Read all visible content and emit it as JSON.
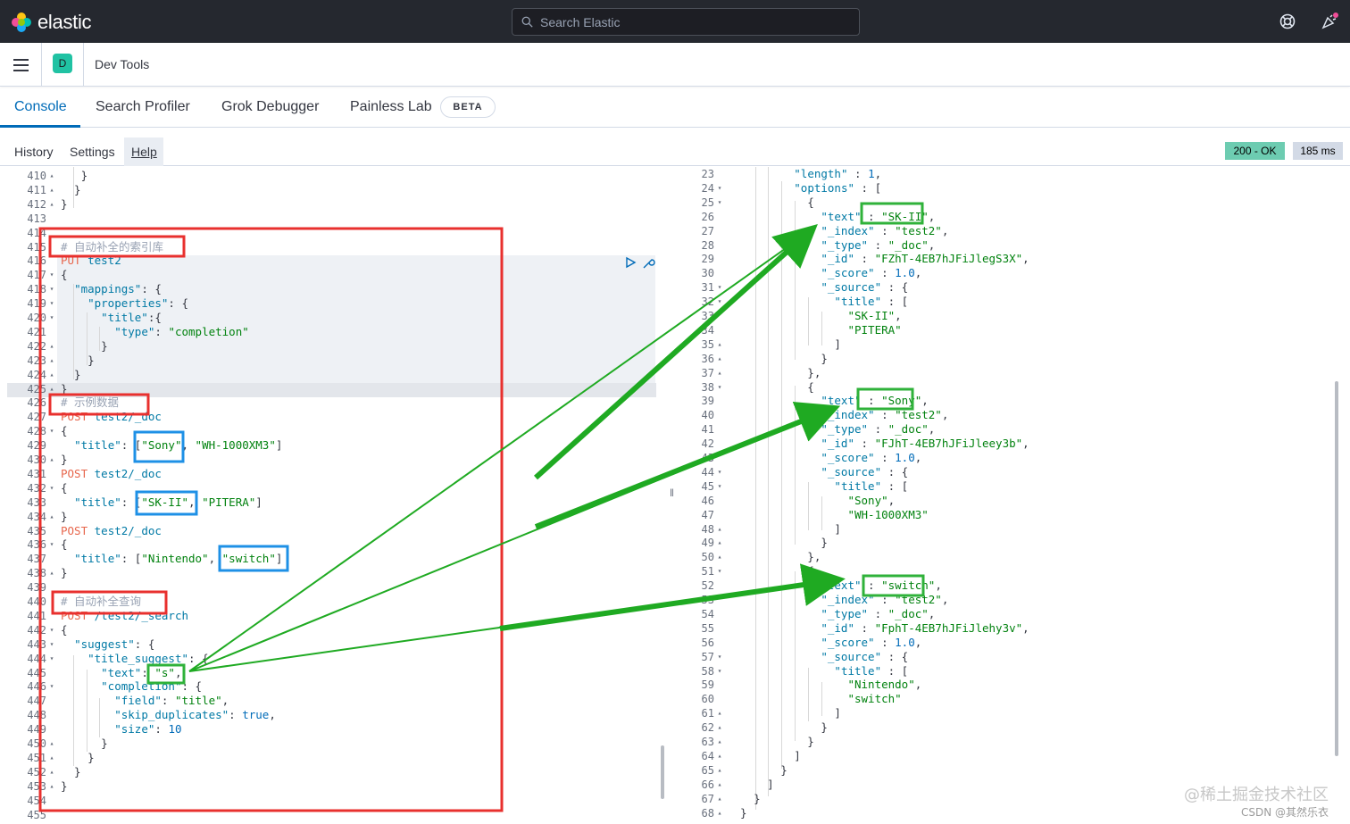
{
  "brand": {
    "name": "elastic"
  },
  "search": {
    "placeholder": "Search Elastic"
  },
  "topbar": {
    "help_icon": "help-lifebuoy-icon",
    "news_icon": "newsfeed-icon"
  },
  "breadcrumb": {
    "avatar_letter": "D",
    "title": "Dev Tools"
  },
  "tabs": [
    {
      "label": "Console",
      "active": true
    },
    {
      "label": "Search Profiler"
    },
    {
      "label": "Grok Debugger"
    },
    {
      "label": "Painless Lab"
    }
  ],
  "beta_badge": "BETA",
  "subnav": {
    "history": "History",
    "settings": "Settings",
    "help": "Help"
  },
  "status": {
    "code": "200 - OK",
    "time": "185 ms",
    "ok_color": "#6dccb1"
  },
  "editor_lines": [
    {
      "n": "410",
      "f": "▴",
      "html": "   }"
    },
    {
      "n": "411",
      "f": "▴",
      "html": "  }"
    },
    {
      "n": "412",
      "f": "▴",
      "html": "}"
    },
    {
      "n": "413",
      "f": "",
      "html": ""
    },
    {
      "n": "414",
      "f": "",
      "html": ""
    },
    {
      "n": "415",
      "f": "",
      "html": "<span class='cm'># 自动补全的索引库</span>"
    },
    {
      "n": "416",
      "f": "",
      "html": "<span class='m'>PUT</span> <span class='k'>test2</span>"
    },
    {
      "n": "417",
      "f": "▾",
      "html": "{"
    },
    {
      "n": "418",
      "f": "▾",
      "html": "  <span class='k'>\"mappings\"</span>: {"
    },
    {
      "n": "419",
      "f": "▾",
      "html": "    <span class='k'>\"properties\"</span>: {"
    },
    {
      "n": "420",
      "f": "▾",
      "html": "      <span class='k'>\"title\"</span>:{"
    },
    {
      "n": "421",
      "f": "",
      "html": "        <span class='k'>\"type\"</span>: <span class='s'>\"completion\"</span>"
    },
    {
      "n": "422",
      "f": "▴",
      "html": "      }"
    },
    {
      "n": "423",
      "f": "▴",
      "html": "    }"
    },
    {
      "n": "424",
      "f": "▴",
      "html": "  }"
    },
    {
      "n": "425",
      "f": "▴",
      "html": "}"
    },
    {
      "n": "426",
      "f": "",
      "html": "<span class='cm'># 示例数据</span>"
    },
    {
      "n": "427",
      "f": "",
      "html": "<span class='m'>POST</span> <span class='k'>test2/_doc</span>"
    },
    {
      "n": "428",
      "f": "▾",
      "html": "{"
    },
    {
      "n": "429",
      "f": "",
      "html": "  <span class='k'>\"title\"</span>: [<span class='s'>\"Sony\"</span>, <span class='s'>\"WH-1000XM3\"</span>]"
    },
    {
      "n": "430",
      "f": "▴",
      "html": "}"
    },
    {
      "n": "431",
      "f": "",
      "html": "<span class='m'>POST</span> <span class='k'>test2/_doc</span>"
    },
    {
      "n": "432",
      "f": "▾",
      "html": "{"
    },
    {
      "n": "433",
      "f": "",
      "html": "  <span class='k'>\"title\"</span>: [<span class='s'>\"SK-II\"</span>, <span class='s'>\"PITERA\"</span>]"
    },
    {
      "n": "434",
      "f": "▴",
      "html": "}"
    },
    {
      "n": "435",
      "f": "",
      "html": "<span class='m'>POST</span> <span class='k'>test2/_doc</span>"
    },
    {
      "n": "436",
      "f": "▾",
      "html": "{"
    },
    {
      "n": "437",
      "f": "",
      "html": "  <span class='k'>\"title\"</span>: [<span class='s'>\"Nintendo\"</span>, <span class='s'>\"switch\"</span>]"
    },
    {
      "n": "438",
      "f": "▴",
      "html": "}"
    },
    {
      "n": "439",
      "f": "",
      "html": ""
    },
    {
      "n": "440",
      "f": "",
      "html": "<span class='cm'># 自动补全查询</span>"
    },
    {
      "n": "441",
      "f": "",
      "html": "<span class='m'>POST</span> <span class='k'>/test2/_search</span>"
    },
    {
      "n": "442",
      "f": "▾",
      "html": "{"
    },
    {
      "n": "443",
      "f": "▾",
      "html": "  <span class='k'>\"suggest\"</span>: {"
    },
    {
      "n": "444",
      "f": "▾",
      "html": "    <span class='k'>\"title_suggest\"</span>: {"
    },
    {
      "n": "445",
      "f": "",
      "html": "      <span class='k'>\"text\"</span>: <span class='s'>\"s\"</span>,"
    },
    {
      "n": "446",
      "f": "▾",
      "html": "      <span class='k'>\"completion\"</span>: {"
    },
    {
      "n": "447",
      "f": "",
      "html": "        <span class='k'>\"field\"</span>: <span class='s'>\"title\"</span>,"
    },
    {
      "n": "448",
      "f": "",
      "html": "        <span class='k'>\"skip_duplicates\"</span>: <span class='num'>true</span>,"
    },
    {
      "n": "449",
      "f": "",
      "html": "        <span class='k'>\"size\"</span>: <span class='num'>10</span>"
    },
    {
      "n": "450",
      "f": "▴",
      "html": "      }"
    },
    {
      "n": "451",
      "f": "▴",
      "html": "    }"
    },
    {
      "n": "452",
      "f": "▴",
      "html": "  }"
    },
    {
      "n": "453",
      "f": "▴",
      "html": "}"
    },
    {
      "n": "454",
      "f": "",
      "html": ""
    },
    {
      "n": "455",
      "f": "",
      "html": ""
    }
  ],
  "output_lines": [
    {
      "n": "23",
      "f": "",
      "html": "          <span class='k'>\"length\"</span> : <span class='num'>1</span>,"
    },
    {
      "n": "24",
      "f": "▾",
      "html": "          <span class='k'>\"options\"</span> : ["
    },
    {
      "n": "25",
      "f": "▾",
      "html": "            {"
    },
    {
      "n": "26",
      "f": "",
      "html": "              <span class='k'>\"text\"</span> : <span class='s'>\"SK-II\"</span>,"
    },
    {
      "n": "27",
      "f": "",
      "html": "              <span class='k'>\"_index\"</span> : <span class='s'>\"test2\"</span>,"
    },
    {
      "n": "28",
      "f": "",
      "html": "              <span class='k'>\"_type\"</span> : <span class='s'>\"_doc\"</span>,"
    },
    {
      "n": "29",
      "f": "",
      "html": "              <span class='k'>\"_id\"</span> : <span class='s'>\"FZhT-4EB7hJFiJlegS3X\"</span>,"
    },
    {
      "n": "30",
      "f": "",
      "html": "              <span class='k'>\"_score\"</span> : <span class='num'>1.0</span>,"
    },
    {
      "n": "31",
      "f": "▾",
      "html": "              <span class='k'>\"_source\"</span> : {"
    },
    {
      "n": "32",
      "f": "▾",
      "html": "                <span class='k'>\"title\"</span> : ["
    },
    {
      "n": "33",
      "f": "",
      "html": "                  <span class='s'>\"SK-II\"</span>,"
    },
    {
      "n": "34",
      "f": "",
      "html": "                  <span class='s'>\"PITERA\"</span>"
    },
    {
      "n": "35",
      "f": "▴",
      "html": "                ]"
    },
    {
      "n": "36",
      "f": "▴",
      "html": "              }"
    },
    {
      "n": "37",
      "f": "▴",
      "html": "            },"
    },
    {
      "n": "38",
      "f": "▾",
      "html": "            {"
    },
    {
      "n": "39",
      "f": "",
      "html": "              <span class='k'>\"text\"</span> : <span class='s'>\"Sony\"</span>,"
    },
    {
      "n": "40",
      "f": "",
      "html": "              <span class='k'>\"_index\"</span> : <span class='s'>\"test2\"</span>,"
    },
    {
      "n": "41",
      "f": "",
      "html": "              <span class='k'>\"_type\"</span> : <span class='s'>\"_doc\"</span>,"
    },
    {
      "n": "42",
      "f": "",
      "html": "              <span class='k'>\"_id\"</span> : <span class='s'>\"FJhT-4EB7hJFiJleey3b\"</span>,"
    },
    {
      "n": "43",
      "f": "",
      "html": "              <span class='k'>\"_score\"</span> : <span class='num'>1.0</span>,"
    },
    {
      "n": "44",
      "f": "▾",
      "html": "              <span class='k'>\"_source\"</span> : {"
    },
    {
      "n": "45",
      "f": "▾",
      "html": "                <span class='k'>\"title\"</span> : ["
    },
    {
      "n": "46",
      "f": "",
      "html": "                  <span class='s'>\"Sony\"</span>,"
    },
    {
      "n": "47",
      "f": "",
      "html": "                  <span class='s'>\"WH-1000XM3\"</span>"
    },
    {
      "n": "48",
      "f": "▴",
      "html": "                ]"
    },
    {
      "n": "49",
      "f": "▴",
      "html": "              }"
    },
    {
      "n": "50",
      "f": "▴",
      "html": "            },"
    },
    {
      "n": "51",
      "f": "▾",
      "html": "            {"
    },
    {
      "n": "52",
      "f": "",
      "html": "              <span class='k'>\"text\"</span> : <span class='s'>\"switch\"</span>,"
    },
    {
      "n": "53",
      "f": "",
      "html": "              <span class='k'>\"_index\"</span> : <span class='s'>\"test2\"</span>,"
    },
    {
      "n": "54",
      "f": "",
      "html": "              <span class='k'>\"_type\"</span> : <span class='s'>\"_doc\"</span>,"
    },
    {
      "n": "55",
      "f": "",
      "html": "              <span class='k'>\"_id\"</span> : <span class='s'>\"FphT-4EB7hJFiJlehy3v\"</span>,"
    },
    {
      "n": "56",
      "f": "",
      "html": "              <span class='k'>\"_score\"</span> : <span class='num'>1.0</span>,"
    },
    {
      "n": "57",
      "f": "▾",
      "html": "              <span class='k'>\"_source\"</span> : {"
    },
    {
      "n": "58",
      "f": "▾",
      "html": "                <span class='k'>\"title\"</span> : ["
    },
    {
      "n": "59",
      "f": "",
      "html": "                  <span class='s'>\"Nintendo\"</span>,"
    },
    {
      "n": "60",
      "f": "",
      "html": "                  <span class='s'>\"switch\"</span>"
    },
    {
      "n": "61",
      "f": "▴",
      "html": "                ]"
    },
    {
      "n": "62",
      "f": "▴",
      "html": "              }"
    },
    {
      "n": "63",
      "f": "▴",
      "html": "            }"
    },
    {
      "n": "64",
      "f": "▴",
      "html": "          ]"
    },
    {
      "n": "65",
      "f": "▴",
      "html": "        }"
    },
    {
      "n": "66",
      "f": "▴",
      "html": "      ]"
    },
    {
      "n": "67",
      "f": "▴",
      "html": "    }"
    },
    {
      "n": "68",
      "f": "▴",
      "html": "  }"
    }
  ],
  "watermark": {
    "line1": "@稀土掘金技术社区",
    "line2": "CSDN @其然乐衣"
  },
  "annotation_colors": {
    "red": "#e8302e",
    "blue": "#1e90e6",
    "green": "#2fb23a",
    "arrow": "#1faa22"
  }
}
